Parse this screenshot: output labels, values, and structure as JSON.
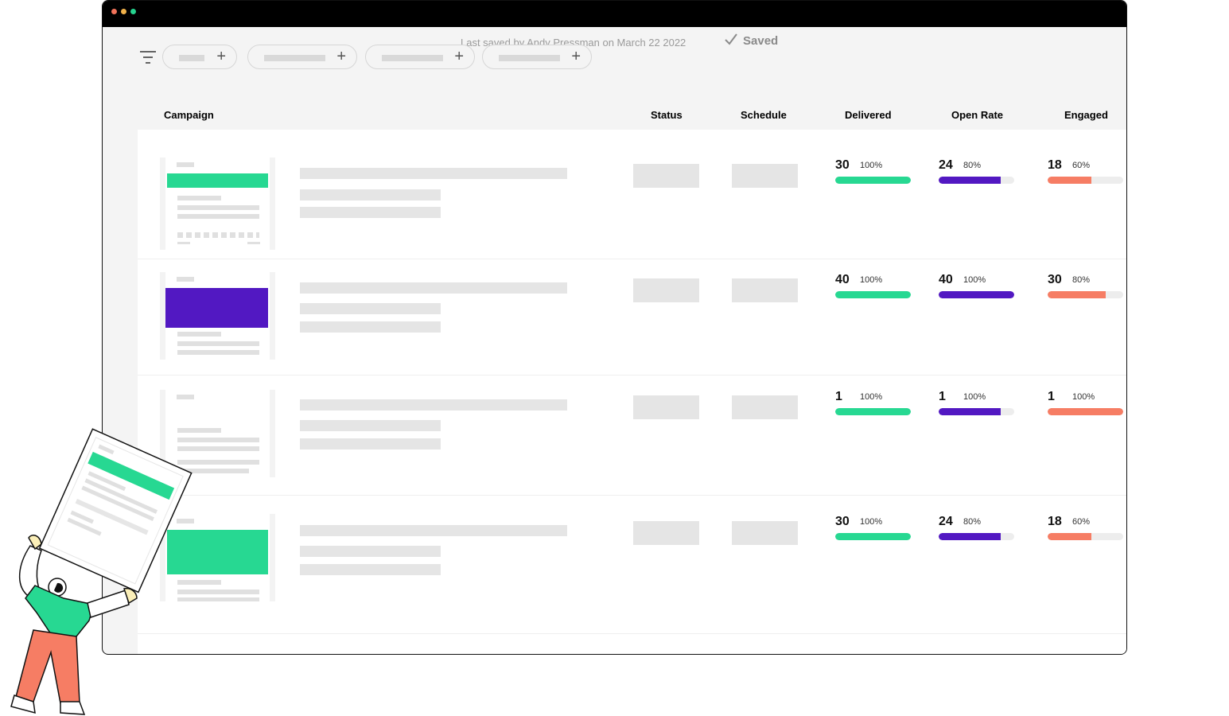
{
  "header": {
    "last_saved": "Last saved by Andy Pressman on March 22 2022",
    "saved_label": "Saved"
  },
  "columns": {
    "campaign": "Campaign",
    "status": "Status",
    "schedule": "Schedule",
    "delivered": "Delivered",
    "open_rate": "Open Rate",
    "engaged": "Engaged"
  },
  "colors": {
    "delivered": "#27d892",
    "open_rate": "#5218c2",
    "engaged": "#f67d64"
  },
  "rows": [
    {
      "thumb_banner_color": "#27d892",
      "delivered": {
        "value": "30",
        "pct": "100%",
        "fill": 1.0
      },
      "open_rate": {
        "value": "24",
        "pct": "80%",
        "fill": 0.82
      },
      "engaged": {
        "value": "18",
        "pct": "60%",
        "fill": 0.58
      }
    },
    {
      "thumb_banner_color": "#5218c2",
      "delivered": {
        "value": "40",
        "pct": "100%",
        "fill": 1.0
      },
      "open_rate": {
        "value": "40",
        "pct": "100%",
        "fill": 1.0
      },
      "engaged": {
        "value": "30",
        "pct": "80%",
        "fill": 0.77
      }
    },
    {
      "thumb_banner_color": "",
      "delivered": {
        "value": "1",
        "pct": "100%",
        "fill": 1.0
      },
      "open_rate": {
        "value": "1",
        "pct": "100%",
        "fill": 0.82
      },
      "engaged": {
        "value": "1",
        "pct": "100%",
        "fill": 1.0
      }
    },
    {
      "thumb_banner_color": "#27d892",
      "delivered": {
        "value": "30",
        "pct": "100%",
        "fill": 1.0
      },
      "open_rate": {
        "value": "24",
        "pct": "80%",
        "fill": 0.82
      },
      "engaged": {
        "value": "18",
        "pct": "60%",
        "fill": 0.58
      }
    }
  ]
}
